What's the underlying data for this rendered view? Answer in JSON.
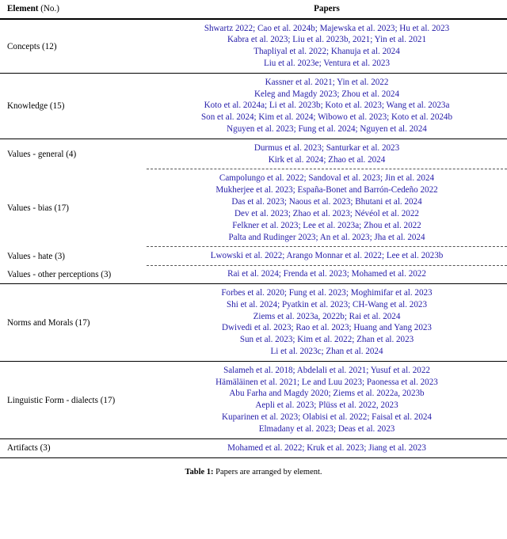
{
  "table": {
    "headers": {
      "element_bold": "Element",
      "element_note": " (No.)",
      "papers": "Papers"
    },
    "accent_citation_color": "#241ca8",
    "rows": [
      {
        "element": "Concepts (12)",
        "dashed_above": false,
        "papers": [
          "Shwartz 2022; Cao et al. 2024b; Majewska et al. 2023; Hu et al. 2023",
          "Kabra et al. 2023; Liu et al. 2023b, 2021; Yin et al. 2021",
          "Thapliyal et al. 2022; Khanuja et al. 2024",
          "Liu et al. 2023e; Ventura et al. 2023"
        ]
      },
      {
        "element": "Knowledge (15)",
        "dashed_above": false,
        "papers": [
          "Kassner et al. 2021; Yin et al. 2022",
          "Keleg and Magdy 2023; Zhou et al. 2024",
          "Koto et al. 2024a; Li et al. 2023b; Koto et al. 2023; Wang et al. 2023a",
          "Son et al. 2024; Kim et al. 2024; Wibowo et al. 2023; Koto et al. 2024b",
          "Nguyen et al. 2023; Fung et al. 2024; Nguyen et al. 2024"
        ]
      },
      {
        "element": "Values - general (4)",
        "dashed_above": false,
        "papers": [
          "Durmus et al. 2023; Santurkar et al. 2023",
          "Kirk et al. 2024; Zhao et al. 2024"
        ]
      },
      {
        "element": "Values - bias (17)",
        "dashed_above": true,
        "papers": [
          "Campolungo et al. 2022; Sandoval et al. 2023; Jin et al. 2024",
          "Mukherjee et al. 2023; España-Bonet and Barrón-Cedeño 2022",
          "Das et al. 2023; Naous et al. 2023; Bhutani et al. 2024",
          "Dev et al. 2023; Zhao et al. 2023; Névéol et al. 2022",
          "Felkner et al. 2023; Lee et al. 2023a; Zhou et al. 2022",
          "Palta and Rudinger 2023; An et al. 2023; Jha et al. 2024"
        ]
      },
      {
        "element": "Values - hate (3)",
        "dashed_above": true,
        "papers": [
          "Lwowski et al. 2022; Arango Monnar et al. 2022; Lee et al. 2023b"
        ]
      },
      {
        "element": "Values - other perceptions (3)",
        "dashed_above": true,
        "papers": [
          "Rai et al. 2024; Frenda et al. 2023; Mohamed et al. 2022"
        ]
      },
      {
        "element": "Norms and Morals (17)",
        "dashed_above": false,
        "papers": [
          "Forbes et al. 2020; Fung et al. 2023; Moghimifar et al. 2023",
          "Shi et al. 2024; Pyatkin et al. 2023; CH-Wang et al. 2023",
          "Ziems et al. 2023a, 2022b; Rai et al. 2024",
          "Dwivedi et al. 2023; Rao et al. 2023; Huang and Yang 2023",
          "Sun et al. 2023; Kim et al. 2022; Zhan et al. 2023",
          "Li et al. 2023c; Zhan et al. 2024"
        ]
      },
      {
        "element": "Linguistic Form - dialects (17)",
        "dashed_above": false,
        "papers": [
          "Salameh et al. 2018; Abdelali et al. 2021; Yusuf et al. 2022",
          "Hämäläinen et al. 2021; Le and Luu 2023; Paonessa et al. 2023",
          "Abu Farha and Magdy 2020; Ziems et al. 2022a, 2023b",
          "Aepli et al. 2023; Plüss et al. 2022, 2023",
          "Kuparinen et al. 2023; Olabisi et al. 2022; Faisal et al. 2024",
          "Elmadany et al. 2023; Deas et al. 2023"
        ]
      },
      {
        "element": "Artifacts (3)",
        "dashed_above": false,
        "papers": [
          "Mohamed et al. 2022; Kruk et al. 2023; Jiang et al. 2023"
        ]
      }
    ]
  },
  "caption": {
    "label": "Table 1: ",
    "text": "Papers are arranged by element."
  }
}
